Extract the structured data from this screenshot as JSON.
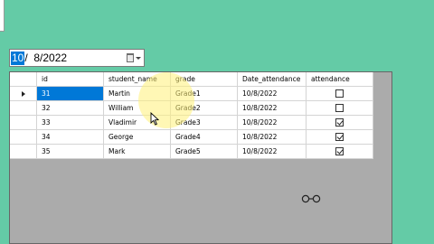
{
  "date_picker": {
    "selected_segment": "10",
    "rest": "/  8/2022",
    "calendar_icon": "calendar-icon",
    "dropdown_icon": "chevron-down-icon"
  },
  "grid": {
    "columns": [
      "id",
      "student_name",
      "grade",
      "Date_attendance",
      "attendance"
    ],
    "rows": [
      {
        "id": "31",
        "student_name": "Martin",
        "grade": "Grade1",
        "date": "10/8/2022",
        "attendance": false,
        "current": true
      },
      {
        "id": "32",
        "student_name": "William",
        "grade": "Grade2",
        "date": "10/8/2022",
        "attendance": false,
        "current": false
      },
      {
        "id": "33",
        "student_name": "Vladimir",
        "grade": "Grade3",
        "date": "10/8/2022",
        "attendance": true,
        "current": false
      },
      {
        "id": "34",
        "student_name": "George",
        "grade": "Grade4",
        "date": "10/8/2022",
        "attendance": true,
        "current": false
      },
      {
        "id": "35",
        "student_name": "Mark",
        "grade": "Grade5",
        "date": "10/8/2022",
        "attendance": true,
        "current": false
      }
    ],
    "selected_cell": "31"
  },
  "colors": {
    "form_background": "#64cba6",
    "grid_background": "#ababab",
    "selection": "#0078d7",
    "cursor_highlight": "#fff078"
  }
}
